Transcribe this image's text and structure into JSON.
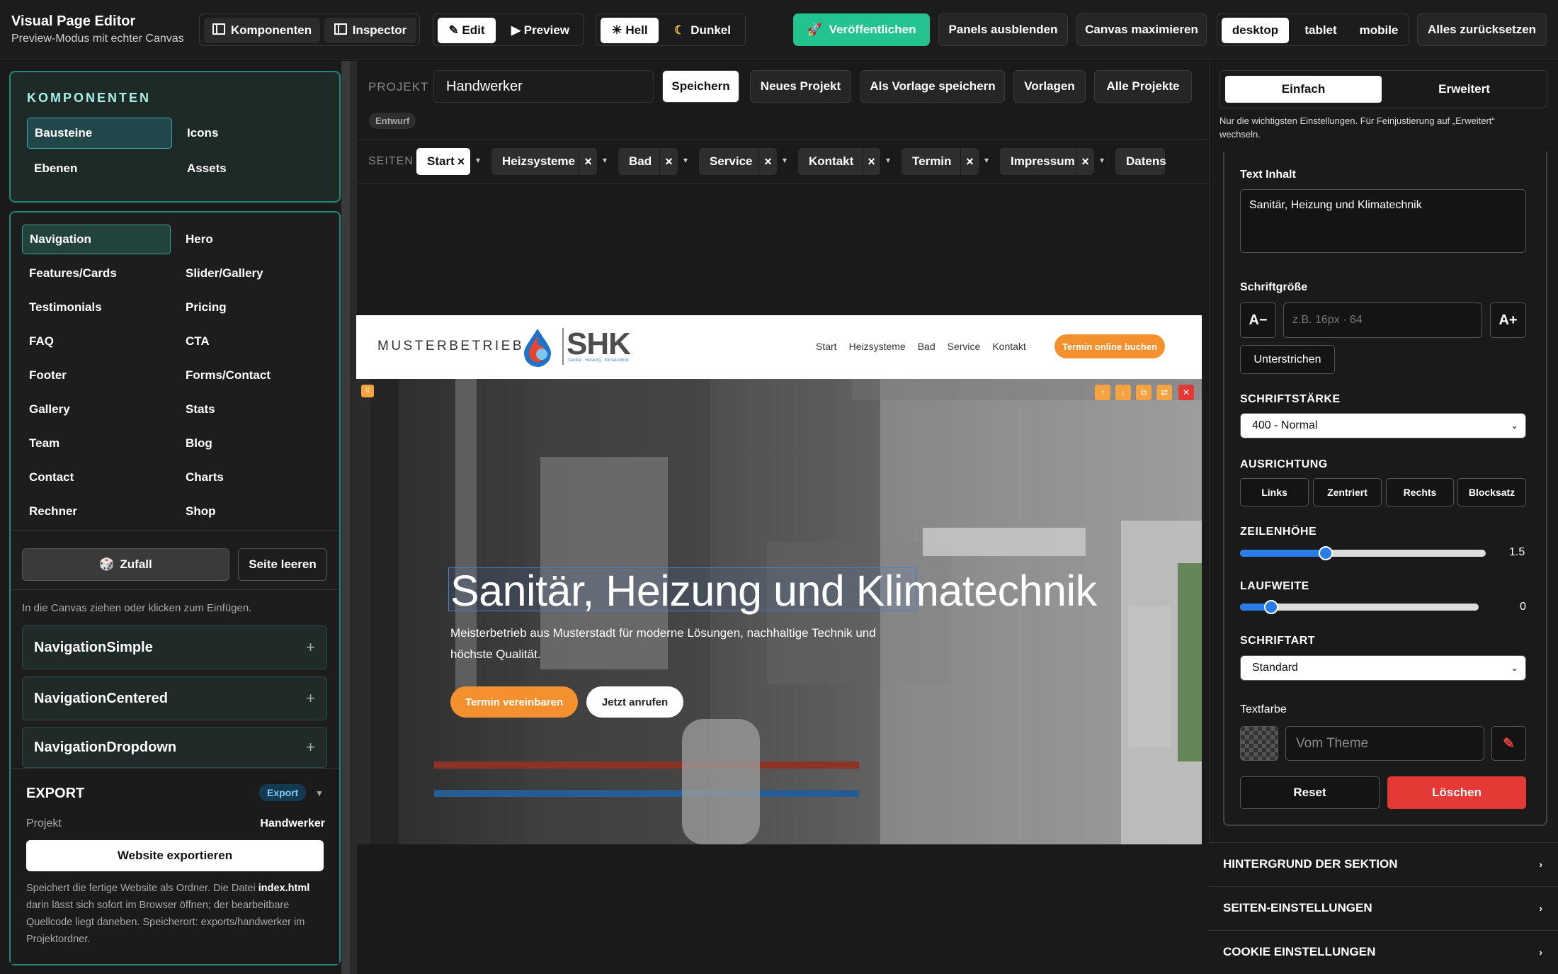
{
  "app": {
    "title": "Visual Page Editor",
    "subtitle": "Preview-Modus mit echter Canvas"
  },
  "toolbar": {
    "komponenten": "Komponenten",
    "inspector": "Inspector",
    "edit": "✎ Edit",
    "preview": "▶ Preview",
    "hell": "☀ Hell",
    "dunkel": "Dunkel",
    "publish": "Veröffentlichen",
    "panels_hide": "Panels ausblenden",
    "canvas_max": "Canvas maximieren",
    "devices": [
      "desktop",
      "tablet",
      "mobile"
    ],
    "reset_all": "Alles zurücksetzen",
    "accent": "#22c38e"
  },
  "left": {
    "components_title": "KOMPONENTEN",
    "component_tabs": [
      "Bausteine",
      "Icons",
      "Ebenen",
      "Assets"
    ],
    "categories": [
      "Navigation",
      "Hero",
      "Features/Cards",
      "Slider/Gallery",
      "Testimonials",
      "Pricing",
      "FAQ",
      "CTA",
      "Footer",
      "Forms/Contact",
      "Gallery",
      "Stats",
      "Team",
      "Blog",
      "Contact",
      "Charts",
      "Rechner",
      "Shop"
    ],
    "random": "Zufall",
    "clear_page": "Seite leeren",
    "hint": "In die Canvas ziehen oder klicken zum Einfügen.",
    "cards": [
      "NavigationSimple",
      "NavigationCentered",
      "NavigationDropdown"
    ],
    "export": {
      "title": "EXPORT",
      "badge": "Export",
      "project_label": "Projekt",
      "project_value": "Handwerker",
      "button": "Website exportieren",
      "desc_1": "Speichert die fertige Website als Ordner. Die Datei ",
      "desc_file": "index.html",
      "desc_2": " darin lässt sich sofort im Browser öffnen; der bearbeitbare Quellcode liegt daneben. Speicherort: exports/handwerker im Projektordner."
    }
  },
  "project": {
    "label": "PROJEKT",
    "name": "Handwerker",
    "status": "Entwurf",
    "buttons": [
      "Speichern",
      "Neues Projekt",
      "Als Vorlage speichern",
      "Vorlagen",
      "Alle Projekte"
    ]
  },
  "pages": {
    "label": "SEITEN",
    "tabs": [
      "Start",
      "Heizsysteme",
      "Bad",
      "Service",
      "Kontakt",
      "Termin",
      "Impressum",
      "Datens"
    ]
  },
  "site": {
    "brand_word": "MUSTERBETRIEB",
    "logo_text": "SHK",
    "logo_tagline": "Sanitär · Heizung · Klimatechnik",
    "nav": [
      "Start",
      "Heizsysteme",
      "Bad",
      "Service",
      "Kontakt"
    ],
    "cta": "Termin online buchen",
    "hero_title": "Sanitär, Heizung und Klimatechnik",
    "hero_text": "Meisterbetrieb aus Musterstadt für moderne Lösungen, nachhaltige Technik und höchste Qualität.",
    "btn_primary": "Termin vereinbaren",
    "btn_secondary": "Jetzt anrufen",
    "orange": "#f5902f"
  },
  "inspector": {
    "tabs": [
      "Einfach",
      "Erweitert"
    ],
    "hint": "Nur die wichtigsten Einstellungen. Für Feinjustierung auf „Erweitert“ wechseln.",
    "text_label": "Text Inhalt",
    "text_value": "Sanitär, Heizung und Klimatechnik",
    "fontsize_label": "Schriftgröße",
    "fontsize_minus": "A−",
    "fontsize_plus": "A+",
    "fontsize_placeholder": "z.B. 16px · 64",
    "underline": "Unterstrichen",
    "weight_label": "SCHRIFTSTÄRKE",
    "weight_value": "400 - Normal",
    "align_label": "AUSRICHTUNG",
    "align_options": [
      "Links",
      "Zentriert",
      "Rechts",
      "Blocksatz"
    ],
    "lineheight_label": "ZEILENHÖHE",
    "lineheight_value": "1.5",
    "lineheight_fraction": 0.35,
    "letterspacing_label": "LAUFWEITE",
    "letterspacing_value": "0",
    "letterspacing_fraction": 0.13,
    "font_label": "SCHRIFTART",
    "font_value": "Standard",
    "color_label": "Textfarbe",
    "color_placeholder": "Vom Theme",
    "reset": "Reset",
    "delete": "Löschen",
    "sections": [
      "HINTERGRUND DER SEKTION",
      "SEITEN-EINSTELLUNGEN",
      "COOKIE EINSTELLUNGEN"
    ]
  }
}
